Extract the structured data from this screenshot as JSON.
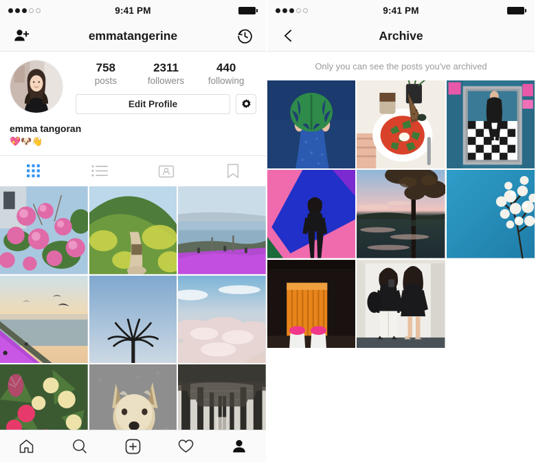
{
  "status_bar": {
    "signal_filled": 3,
    "signal_empty": 2,
    "time": "9:41 PM",
    "battery_full": true
  },
  "profile_screen": {
    "header": {
      "add_person_icon": "add-person-icon",
      "title": "emmatangerine",
      "archive_icon": "archive-history-icon"
    },
    "avatar_alt": "emma tangoran profile photo",
    "stats": [
      {
        "num": "758",
        "label": "posts"
      },
      {
        "num": "2311",
        "label": "followers"
      },
      {
        "num": "440",
        "label": "following"
      }
    ],
    "edit_profile_label": "Edit Profile",
    "settings_icon": "gear-icon",
    "full_name": "emma tangoran",
    "bio": "💖🐶👋",
    "tabs": [
      {
        "name": "grid",
        "active": true
      },
      {
        "name": "list",
        "active": false
      },
      {
        "name": "tagged",
        "active": false
      },
      {
        "name": "saved",
        "active": false
      }
    ],
    "grid_posts": [
      {
        "alt": "pink cherry blossoms against blue sky"
      },
      {
        "alt": "green hillside trail with yellow wildflowers"
      },
      {
        "alt": "coastal road with purple ice plant and city skyline"
      },
      {
        "alt": "sunset over ocean with flying bird and purple flowers"
      },
      {
        "alt": "palm tree silhouette against blue sky"
      },
      {
        "alt": "clouds seen from above at dusk"
      },
      {
        "alt": "bouquet of pink peonies and protea flowers"
      },
      {
        "alt": "scruffy terrier dog looking up on pavement"
      },
      {
        "alt": "underside of a wooden pier on the beach"
      }
    ],
    "bottom_nav": [
      {
        "name": "home",
        "active": false
      },
      {
        "name": "search",
        "active": false
      },
      {
        "name": "add-post",
        "active": false
      },
      {
        "name": "activity",
        "active": false
      },
      {
        "name": "profile",
        "active": true
      }
    ]
  },
  "archive_screen": {
    "header": {
      "back_icon": "chevron-left-icon",
      "title": "Archive"
    },
    "notice": "Only you can see the posts you've archived",
    "grid_posts": [
      {
        "alt": "person in blue dress holding monstera leaf over face"
      },
      {
        "alt": "shakshuka breakfast plate with bread and coffee"
      },
      {
        "alt": "mirror selfie in hallway with checkered floor"
      },
      {
        "alt": "person in black against pink and blue geometric wall"
      },
      {
        "alt": "lake at dusk reflecting trees and pink sky"
      },
      {
        "alt": "white blossoming tree branch against blue sky"
      },
      {
        "alt": "pink shoes in front of orange curtain in dark room"
      },
      {
        "alt": "two people in black tops mirror selfie"
      }
    ]
  },
  "colors": {
    "accent_blue": "#3897f0",
    "text_primary": "#1a1a1a",
    "text_muted": "#8a8a8a",
    "border": "#e4e4e4",
    "bar_bg": "#fafafa"
  }
}
